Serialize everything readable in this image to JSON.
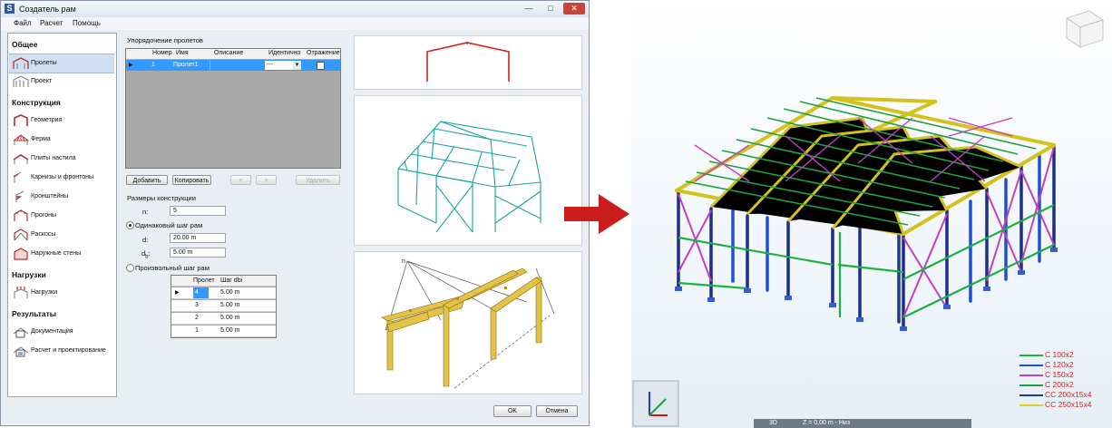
{
  "window": {
    "title": "Создатель рам",
    "menu": [
      "Файл",
      "Расчет",
      "Помощь"
    ]
  },
  "sidebar": {
    "sections": [
      "Общее",
      "Конструкция",
      "Нагрузки",
      "Результаты"
    ],
    "items": [
      {
        "label": "Пролеты",
        "selected": true
      },
      {
        "label": "Проект"
      },
      {
        "label": "Геометрия"
      },
      {
        "label": "Ферма"
      },
      {
        "label": "Плиты настила"
      },
      {
        "label": "Карнизы и фронтоны"
      },
      {
        "label": "Кронштейны"
      },
      {
        "label": "Прогоны"
      },
      {
        "label": "Раскосы"
      },
      {
        "label": "Наружные стены"
      },
      {
        "label": "Нагрузки"
      },
      {
        "label": "Документация"
      },
      {
        "label": "Расчет и проектирование"
      }
    ]
  },
  "spans": {
    "group_title": "Упорядочение пролетов",
    "columns": [
      "Номер",
      "Имя",
      "Описание",
      "Идентично",
      "Отражение"
    ],
    "rows": [
      {
        "number": "1",
        "name": "Пролет1",
        "description": "",
        "identical": "---",
        "mirror": false
      }
    ],
    "buttons": {
      "add": "Добавить",
      "copy": "Копировать",
      "prev": "<",
      "next": ">",
      "delete": "Удалить"
    }
  },
  "dimensions": {
    "group_title": "Размеры конструкции",
    "n_label": "n:",
    "n_value": "5",
    "equal_label": "Одинаковый шаг рам",
    "d_label": "d:",
    "d_value": "20.00 m",
    "db_label_main": "d",
    "db_label_sub": "b",
    "db_value": "5.00 m",
    "arbitrary_label": "Произвольный шаг рам",
    "subgrid_cols": [
      "Пролет",
      "Шаг dbi"
    ],
    "subgrid_rows": [
      {
        "span": "4",
        "step": "5.00 m"
      },
      {
        "span": "3",
        "step": "5.00 m"
      },
      {
        "span": "2",
        "step": "5.00 m"
      },
      {
        "span": "1",
        "step": "5.00 m"
      }
    ]
  },
  "preview": {
    "n_label": "n"
  },
  "footer": {
    "ok": "OK",
    "cancel": "Отмена"
  },
  "view3d": {
    "status_mode": "3D",
    "status_z": "Z = 0,00 m - Низ",
    "legend": [
      {
        "label": "С 100x2",
        "color": "#20b040"
      },
      {
        "label": "С 120x2",
        "color": "#2050d0"
      },
      {
        "label": "С 150x2",
        "color": "#c040c0"
      },
      {
        "label": "С 200x2",
        "color": "#20a040"
      },
      {
        "label": "СС 200x15x4",
        "color": "#203a90"
      },
      {
        "label": "СС 250x15x4",
        "color": "#e0d020"
      }
    ]
  },
  "colors": {
    "arrow": "#cc1d1d",
    "selection": "#3399ff",
    "timber": "#e3c24a"
  }
}
